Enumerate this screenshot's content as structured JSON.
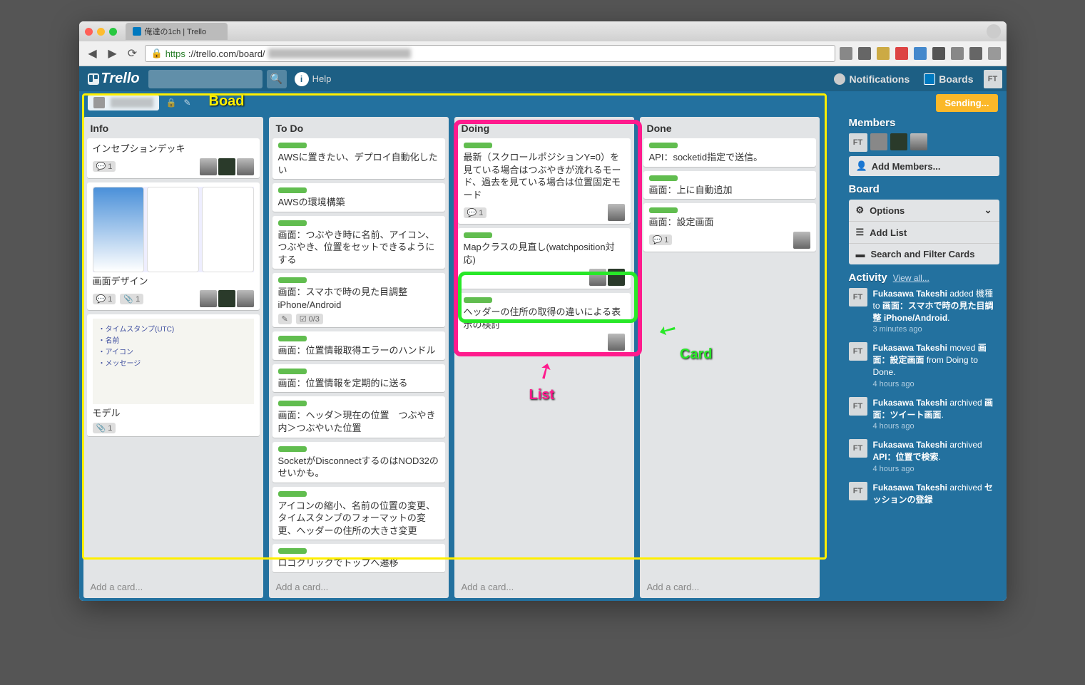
{
  "browser": {
    "tab_title": "俺達の1ch | Trello",
    "url_prefix": "https",
    "url": "://trello.com/board/"
  },
  "header": {
    "logo": "Trello",
    "help": "Help",
    "notifications": "Notifications",
    "boards": "Boards",
    "avatar_initials": "FT"
  },
  "board": {
    "sending": "Sending..."
  },
  "annotations": {
    "board": "Boad",
    "list": "List",
    "card": "Card"
  },
  "lists": [
    {
      "title": "Info",
      "cards": [
        {
          "text": "インセプションデッキ",
          "comments": 1,
          "members": 3
        },
        {
          "text": "画面デザイン",
          "comments": 1,
          "attachments": 1,
          "members": 3,
          "cover": "phones"
        },
        {
          "text": "モデル",
          "attachments": 1,
          "cover": "whiteboard"
        }
      ],
      "add": "Add a card..."
    },
    {
      "title": "To Do",
      "cards": [
        {
          "text": "AWSに置きたい、デプロイ自動化したい",
          "label": true
        },
        {
          "text": "AWSの環境構築",
          "label": true
        },
        {
          "text": "画面：つぶやき時に名前、アイコン、つぶやき、位置をセットできるようにする",
          "label": true
        },
        {
          "text": "画面：スマホで時の見た目調整 iPhone/Android",
          "label": true,
          "checklist": "0/3",
          "edit": true
        },
        {
          "text": "画面：位置情報取得エラーのハンドル",
          "label": true
        },
        {
          "text": "画面：位置情報を定期的に送る",
          "label": true
        },
        {
          "text": "画面：ヘッダ＞現在の位置　つぶやき内＞つぶやいた位置",
          "label": true
        },
        {
          "text": "SocketがDisconnectするのはNOD32のせいかも。",
          "label": true
        },
        {
          "text": "アイコンの縮小、名前の位置の変更、タイムスタンプのフォーマットの変更、ヘッダーの住所の大きさ変更",
          "label": true
        },
        {
          "text": "ロゴクリックでトップへ遷移",
          "label": true
        }
      ],
      "add": "Add a card..."
    },
    {
      "title": "Doing",
      "cards": [
        {
          "text": "最新（スクロールポジションY=0）を見ている場合はつぶやきが流れるモード、過去を見ている場合は位置固定モード",
          "label": true,
          "comments": 1,
          "members": 1
        },
        {
          "text": "Mapクラスの見直し(watchposition対応)",
          "label": true,
          "members": 2
        },
        {
          "text": "ヘッダーの住所の取得の違いによる表示の検討",
          "label": true,
          "members": 1
        }
      ],
      "add": "Add a card..."
    },
    {
      "title": "Done",
      "cards": [
        {
          "text": "API：socketid指定で送信。",
          "label": true
        },
        {
          "text": "画面：上に自動追加",
          "label": true
        },
        {
          "text": "画面：設定画面",
          "label": true,
          "comments": 1,
          "members": 1
        }
      ],
      "add": "Add a card..."
    }
  ],
  "sidebar": {
    "members_title": "Members",
    "add_members": "Add Members...",
    "board_title": "Board",
    "options": "Options",
    "add_list": "Add List",
    "search_filter": "Search and Filter Cards",
    "activity_title": "Activity",
    "view_all": "View all...",
    "activity": [
      {
        "initials": "FT",
        "actor": "Fukasawa Takeshi",
        "action": " added 機種 to ",
        "target": "画面：スマホで時の見た目調整 iPhone/Android",
        "suffix": ".",
        "time": "3 minutes ago"
      },
      {
        "initials": "FT",
        "actor": "Fukasawa Takeshi",
        "action": " moved ",
        "target": "画面：設定画面",
        "suffix": " from Doing to Done.",
        "time": "4 hours ago"
      },
      {
        "initials": "FT",
        "actor": "Fukasawa Takeshi",
        "action": " archived ",
        "target": "画面：ツイート画面",
        "suffix": ".",
        "time": "4 hours ago"
      },
      {
        "initials": "FT",
        "actor": "Fukasawa Takeshi",
        "action": " archived ",
        "target": "API：位置で検索",
        "suffix": ".",
        "time": "4 hours ago"
      },
      {
        "initials": "FT",
        "actor": "Fukasawa Takeshi",
        "action": " archived ",
        "target": "セッションの登録",
        "suffix": "",
        "time": ""
      }
    ]
  },
  "whiteboard_lines": [
    "・タイムスタンプ(UTC)",
    "・名前",
    "・アイコン",
    "・メッセージ"
  ]
}
